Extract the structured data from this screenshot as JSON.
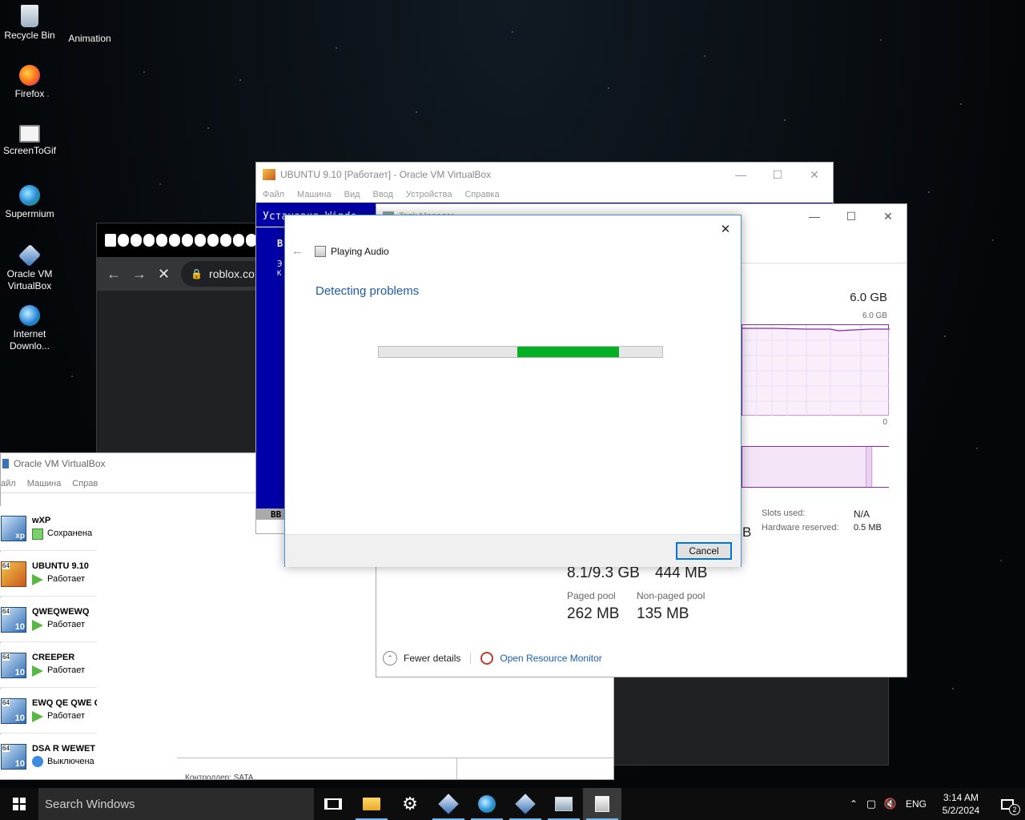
{
  "desktop": {
    "icons": [
      {
        "label": "Recycle Bin"
      },
      {
        "label": "Animation"
      },
      {
        "label": "Firefox"
      },
      {
        "label": "ScreenToGif"
      },
      {
        "label": "Supermium"
      },
      {
        "label": "Oracle VM VirtualBox"
      },
      {
        "label": "Internet Downlo..."
      }
    ]
  },
  "browser": {
    "url": "roblox.co"
  },
  "vbox_manager": {
    "title": "Oracle VM VirtualBox",
    "menu": [
      "айл",
      "Машина",
      "Справ"
    ],
    "vms": [
      {
        "name": "wXP",
        "state": "Сохранена",
        "badge": "xp"
      },
      {
        "name": "UBUNTU 9.10",
        "state": "Работает",
        "badge": ""
      },
      {
        "name": "QWEQWEWQ",
        "state": "Работает",
        "badge": "10"
      },
      {
        "name": "CREEPER",
        "state": "Работает",
        "badge": "10"
      },
      {
        "name": "EWQ QE QWE Q",
        "state": "Работает",
        "badge": "10"
      },
      {
        "name": "DSA R WEWET",
        "state": "Выключена",
        "badge": "10"
      }
    ],
    "footer": "Контроллер: SATA"
  },
  "ubuntu_vm": {
    "title": "UBUNTU 9.10 [Работает] - Oracle VM VirtualBox",
    "menu": [
      "Файл",
      "Машина",
      "Вид",
      "Ввод",
      "Устройства",
      "Справка"
    ],
    "screen_text": "Установка Windo",
    "side_b": "B",
    "side_3": "Э",
    "side_k": "К",
    "bottom_bb": "BB"
  },
  "task_manager": {
    "title": "Task Manager",
    "mem_total": "6.0 GB",
    "graph_top": "6.0 GB",
    "graph_zero": "0",
    "slots_label": "Slots used:",
    "slots_value": "N/A",
    "hw_label": "Hardware reserved:",
    "hw_value": "0.5 MB",
    "b_fragment": "B",
    "committed_value": "8.1/9.3 GB",
    "cached_value": "444 MB",
    "paged_label": "Paged pool",
    "paged_value": "262 MB",
    "nonpaged_label": "Non-paged pool",
    "nonpaged_value": "135 MB",
    "fewer_details": "Fewer details",
    "resource_monitor": "Open Resource Monitor"
  },
  "troubleshooter": {
    "header": "Playing Audio",
    "status": "Detecting problems",
    "progress_fraction": 0.36,
    "progress_start": 0.49,
    "cancel": "Cancel",
    "accent": "#1e5ba8",
    "progress_color": "#06b025"
  },
  "taskbar": {
    "search_placeholder": "Search Windows",
    "lang": "ENG",
    "time": "3:14 AM",
    "date": "5/2/2024",
    "notifications": "2"
  }
}
